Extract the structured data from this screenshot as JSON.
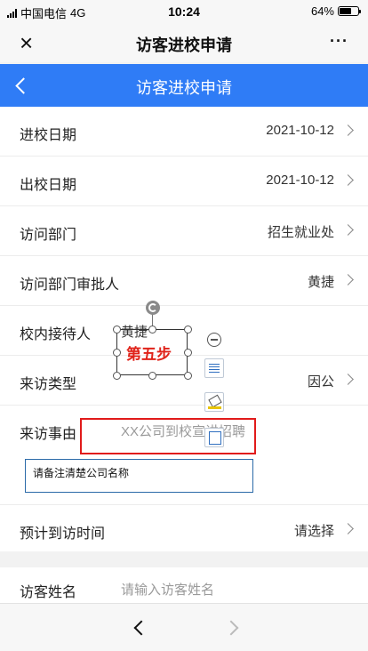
{
  "status_bar": {
    "carrier": "中国电信",
    "network": "4G",
    "time": "10:24",
    "battery": "64%",
    "battery_level": 0.64
  },
  "wechat_bar": {
    "title": "访客进校申请",
    "more": "···",
    "close": "×"
  },
  "header": {
    "title": "访客进校申请"
  },
  "form": {
    "rows": [
      {
        "label": "进校日期",
        "value": "2021-10-12"
      },
      {
        "label": "出校日期",
        "value": "2021-10-12"
      },
      {
        "label": "访问部门",
        "value": "招生就业处"
      },
      {
        "label": "访问部门审批人",
        "value": "黄捷"
      },
      {
        "label": "校内接待人",
        "value": "黄捷"
      },
      {
        "label": "来访类型",
        "value": "因公"
      },
      {
        "label": "来访事由",
        "value": "XX公司到校宣讲招聘"
      },
      {
        "label": "预计到访时间",
        "value": "请选择"
      },
      {
        "label": "访客姓名",
        "placeholder": "请输入访客姓名"
      }
    ]
  },
  "annotation": {
    "step_text": "第五步",
    "remark_text": "请备注清楚公司名称"
  },
  "bottom_nav": {
    "back": "<",
    "forward": ">"
  }
}
